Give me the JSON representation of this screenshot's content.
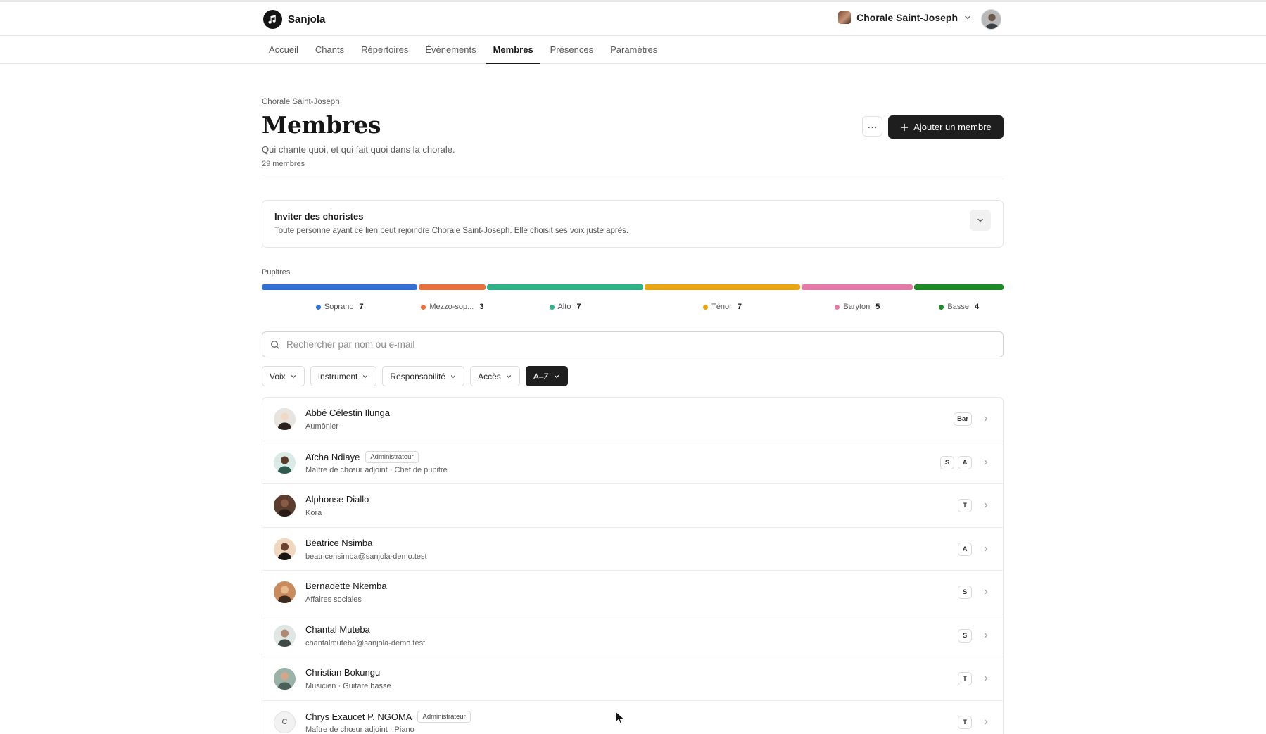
{
  "app": {
    "name": "Sanjola"
  },
  "header": {
    "choir_name": "Chorale Saint-Joseph"
  },
  "nav": {
    "tabs": [
      {
        "label": "Accueil"
      },
      {
        "label": "Chants"
      },
      {
        "label": "Répertoires"
      },
      {
        "label": "Événements"
      },
      {
        "label": "Membres"
      },
      {
        "label": "Présences"
      },
      {
        "label": "Paramètres"
      }
    ],
    "active": "Membres"
  },
  "page": {
    "breadcrumb": "Chorale Saint-Joseph",
    "title": "Membres",
    "subtitle": "Qui chante quoi, et qui fait quoi dans la chorale.",
    "count": "29 membres",
    "more_label": "···",
    "add_label": "Ajouter un membre"
  },
  "invite": {
    "title": "Inviter des choristes",
    "description": "Toute personne ayant ce lien peut rejoindre Chorale Saint-Joseph. Elle choisit ses voix juste après."
  },
  "pupitres": {
    "label": "Pupitres",
    "items": [
      {
        "name": "Soprano",
        "count": "7",
        "color": "#2f72d4"
      },
      {
        "name": "Mezzo-sop...",
        "count": "3",
        "color": "#e8703a"
      },
      {
        "name": "Alto",
        "count": "7",
        "color": "#2eb386"
      },
      {
        "name": "Ténor",
        "count": "7",
        "color": "#e9a512"
      },
      {
        "name": "Baryton",
        "count": "5",
        "color": "#e47ba6"
      },
      {
        "name": "Basse",
        "count": "4",
        "color": "#1c8a25"
      }
    ]
  },
  "search": {
    "placeholder": "Rechercher par nom ou e-mail"
  },
  "filters": {
    "voix": "Voix",
    "instrument": "Instrument",
    "responsabilite": "Responsabilité",
    "acces": "Accès",
    "sort": "A–Z"
  },
  "members": [
    {
      "name": "Abbé Célestin Ilunga",
      "badge": "",
      "sub": "Aumônier",
      "voices": [
        "Bar"
      ],
      "avatar_initial": ""
    },
    {
      "name": "Aïcha Ndiaye",
      "badge": "Administrateur",
      "sub": "Maître de chœur adjoint · Chef de pupitre",
      "voices": [
        "S",
        "A"
      ],
      "avatar_initial": ""
    },
    {
      "name": "Alphonse Diallo",
      "badge": "",
      "sub": "Kora",
      "voices": [
        "T"
      ],
      "avatar_initial": ""
    },
    {
      "name": "Béatrice Nsimba",
      "badge": "",
      "sub": "beatricensimba@sanjola-demo.test",
      "voices": [
        "A"
      ],
      "avatar_initial": ""
    },
    {
      "name": "Bernadette Nkemba",
      "badge": "",
      "sub": "Affaires sociales",
      "voices": [
        "S"
      ],
      "avatar_initial": ""
    },
    {
      "name": "Chantal Muteba",
      "badge": "",
      "sub": "chantalmuteba@sanjola-demo.test",
      "voices": [
        "S"
      ],
      "avatar_initial": ""
    },
    {
      "name": "Christian Bokungu",
      "badge": "",
      "sub": "Musicien · Guitare basse",
      "voices": [
        "T"
      ],
      "avatar_initial": ""
    },
    {
      "name": "Chrys Exaucet P. NGOMA",
      "badge": "Administrateur",
      "sub": "Maître de chœur adjoint · Piano",
      "voices": [
        "T"
      ],
      "avatar_initial": "C"
    }
  ],
  "colors": {
    "primary_button": "#1e1e1e",
    "accent_border": "#1b1b1b"
  }
}
